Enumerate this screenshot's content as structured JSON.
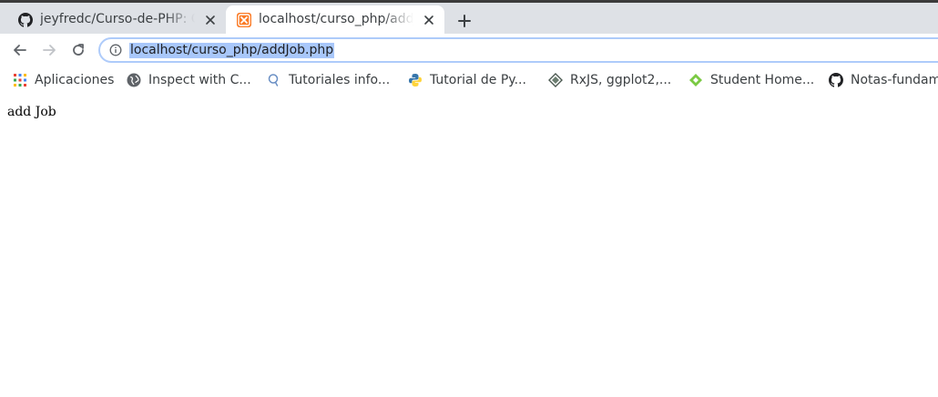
{
  "tabs": [
    {
      "title": "jeyfredc/Curso-de-PHP: C",
      "favicon": "github-icon",
      "active": false
    },
    {
      "title": "localhost/curso_php/addJob.php",
      "favicon": "xampp-icon",
      "active": true
    }
  ],
  "new_tab_icon": "plus-icon",
  "toolbar": {
    "back_icon": "back-arrow-icon",
    "forward_icon": "forward-arrow-icon",
    "reload_icon": "reload-icon",
    "site_info_icon": "info-icon",
    "url": "localhost/curso_php/addJob.php"
  },
  "bookmarks": [
    {
      "label": "Aplicaciones",
      "icon": "apps-grid-icon"
    },
    {
      "label": "Inspect with C...",
      "icon": "globe-icon"
    },
    {
      "label": "Tutoriales info...",
      "icon": "search-bookmark-icon"
    },
    {
      "label": "Tutorial de Py...",
      "icon": "python-icon"
    },
    {
      "label": "RxJS, ggplot2,...",
      "icon": "diamond-icon"
    },
    {
      "label": "Student Home...",
      "icon": "green-diamond-icon"
    },
    {
      "label": "Notas-fundam",
      "icon": "github-icon"
    }
  ],
  "page": {
    "body_text": "add Job"
  },
  "colors": {
    "tabbar_bg": "#dee1e6",
    "url_highlight": "#a8c7fa",
    "omnibox_border": "#aecbfa"
  }
}
